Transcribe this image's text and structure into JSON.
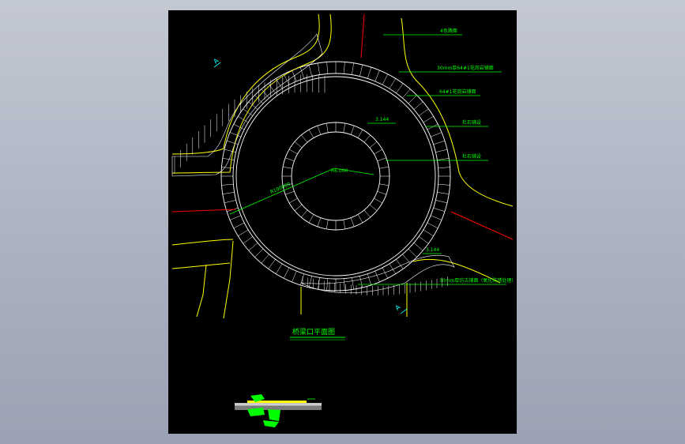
{
  "drawing": {
    "title": "桥梁口平面图",
    "section_markers": [
      "A",
      "A"
    ],
    "elevations": [
      "3.144",
      "3.144"
    ],
    "dimensions": {
      "outer_radius": "R100000",
      "inner_radius": "R6.000"
    },
    "annotations": [
      "4色路面",
      "30mm厚64#1花岗岩铺面",
      "64#1花岗岩铺面",
      "杜石铺设",
      "杜石铺设",
      "30mm厚仿古铺面（氧化防锈处理）"
    ],
    "colors": {
      "background": "#000000",
      "road_edge": "#ffff00",
      "circle": "#ffffff",
      "boundary": "#ff0000",
      "leader": "#00ff00",
      "marker": "#00ffff"
    }
  }
}
